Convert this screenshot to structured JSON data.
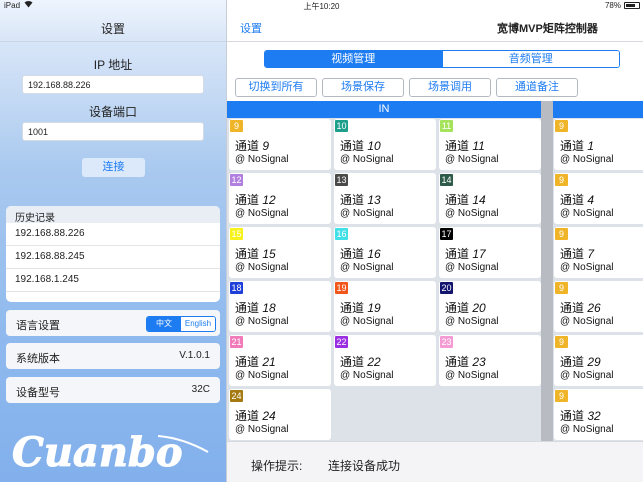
{
  "statusbar": {
    "device": "iPad",
    "time": "上午10:20",
    "battery": "78%"
  },
  "left": {
    "title": "设置",
    "ip_label": "IP 地址",
    "ip_value": "192.168.88.226",
    "port_label": "设备端口",
    "port_value": "1001",
    "connect_label": "连接",
    "history": {
      "title": "历史记录",
      "items": [
        "192.168.88.226",
        "192.168.88.245",
        "192.168.1.245"
      ]
    },
    "language": {
      "label": "语言设置",
      "options": [
        "中文",
        "English"
      ],
      "selected": "中文"
    },
    "version": {
      "label": "系统版本",
      "value": "V.1.0.1"
    },
    "model": {
      "label": "设备型号",
      "value": "32C"
    },
    "logo_text": "Cuanbo"
  },
  "right": {
    "nav": {
      "back_label": "设置",
      "title": "宽博MVP矩阵控制器"
    },
    "tabs": [
      "视频管理",
      "音频管理"
    ],
    "active_tab": "视频管理",
    "actions": [
      "切换到所有",
      "场景保存",
      "场景调用",
      "通道备注"
    ],
    "in_label": "IN",
    "channel_prefix": "通道",
    "signal_text": "@ NoSignal",
    "in_channels": [
      {
        "badge": "9",
        "num": "9",
        "color": "#f0b429"
      },
      {
        "badge": "10",
        "num": "10",
        "color": "#1e9f8c"
      },
      {
        "badge": "11",
        "num": "11",
        "color": "#a6e35c"
      },
      {
        "badge": "12",
        "num": "12",
        "color": "#b07fe0"
      },
      {
        "badge": "13",
        "num": "13",
        "color": "#4a4a4a"
      },
      {
        "badge": "14",
        "num": "14",
        "color": "#2e5a4a"
      },
      {
        "badge": "15",
        "num": "15",
        "color": "#f7f21a"
      },
      {
        "badge": "16",
        "num": "16",
        "color": "#3fe0e8"
      },
      {
        "badge": "17",
        "num": "17",
        "color": "#000000"
      },
      {
        "badge": "18",
        "num": "18",
        "color": "#1e3fd8"
      },
      {
        "badge": "19",
        "num": "19",
        "color": "#f2561a"
      },
      {
        "badge": "20",
        "num": "20",
        "color": "#12146e"
      },
      {
        "badge": "21",
        "num": "21",
        "color": "#f07bb8"
      },
      {
        "badge": "22",
        "num": "22",
        "color": "#9b2ee0"
      },
      {
        "badge": "23",
        "num": "23",
        "color": "#f59ad3"
      },
      {
        "badge": "24",
        "num": "24",
        "color": "#a57a12"
      }
    ],
    "out_channels": [
      {
        "badge": "9",
        "num": "1",
        "color": "#f0b429"
      },
      {
        "badge": "9",
        "num": "4",
        "color": "#f0b429"
      },
      {
        "badge": "9",
        "num": "7",
        "color": "#f0b429"
      },
      {
        "badge": "9",
        "num": "26",
        "color": "#f0b429"
      },
      {
        "badge": "9",
        "num": "29",
        "color": "#f0b429"
      },
      {
        "badge": "9",
        "num": "32",
        "color": "#f0b429"
      }
    ],
    "footer": {
      "label": "操作提示:",
      "value": "连接设备成功"
    }
  }
}
